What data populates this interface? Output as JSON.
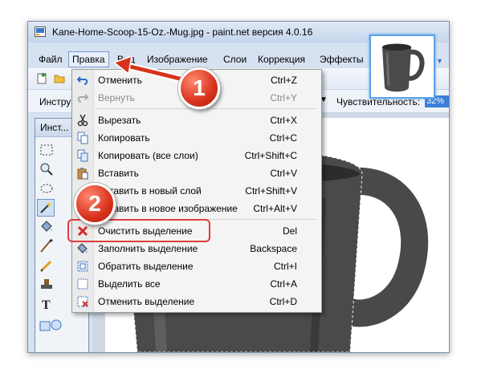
{
  "window": {
    "title": "Kane-Home-Scoop-15-Oz.-Mug.jpg - paint.net версия 4.0.16"
  },
  "menubar": {
    "items": [
      {
        "label": "Файл"
      },
      {
        "label": "Правка"
      },
      {
        "label": "Вид"
      },
      {
        "label": "Изображение"
      },
      {
        "label": "Слои"
      },
      {
        "label": "Коррекция"
      },
      {
        "label": "Эффекты"
      }
    ]
  },
  "toolbar": {
    "tool_label": "Инстру",
    "sensitivity_label": "Чувствительность:",
    "sensitivity_value": "32%"
  },
  "tools_panel": {
    "title": "Инст..."
  },
  "edit_menu": {
    "items": [
      {
        "label": "Отменить",
        "shortcut": "Ctrl+Z",
        "icon": "undo-icon",
        "enabled": true
      },
      {
        "label": "Вернуть",
        "shortcut": "Ctrl+Y",
        "icon": "redo-icon",
        "enabled": false
      },
      {
        "label": "Вырезать",
        "shortcut": "Ctrl+X",
        "icon": "scissors-icon",
        "enabled": true
      },
      {
        "label": "Копировать",
        "shortcut": "Ctrl+C",
        "icon": "copy-icon",
        "enabled": true
      },
      {
        "label": "Копировать (все слои)",
        "shortcut": "Ctrl+Shift+C",
        "icon": "copy-all-icon",
        "enabled": true
      },
      {
        "label": "Вставить",
        "shortcut": "Ctrl+V",
        "icon": "paste-icon",
        "enabled": true
      },
      {
        "label": "Вставить в новый слой",
        "shortcut": "Ctrl+Shift+V",
        "icon": "",
        "enabled": true
      },
      {
        "label": "Вставить в новое изображение",
        "shortcut": "Ctrl+Alt+V",
        "icon": "",
        "enabled": true
      },
      {
        "label": "Очистить выделение",
        "shortcut": "Del",
        "icon": "clear-x-icon",
        "enabled": true
      },
      {
        "label": "Заполнить выделение",
        "shortcut": "Backspace",
        "icon": "fill-icon",
        "enabled": true
      },
      {
        "label": "Обратить выделение",
        "shortcut": "Ctrl+I",
        "icon": "invert-icon",
        "enabled": true
      },
      {
        "label": "Выделить все",
        "shortcut": "Ctrl+A",
        "icon": "select-all-icon",
        "enabled": true
      },
      {
        "label": "Отменить выделение",
        "shortcut": "Ctrl+D",
        "icon": "deselect-icon",
        "enabled": true
      }
    ]
  },
  "annotations": {
    "step1": "1",
    "step2": "2"
  },
  "colors": {
    "accent": "#3c7fd8",
    "highlight": "#e03c3c",
    "badge": "#d8321c",
    "mug": "#4a4a4a"
  }
}
